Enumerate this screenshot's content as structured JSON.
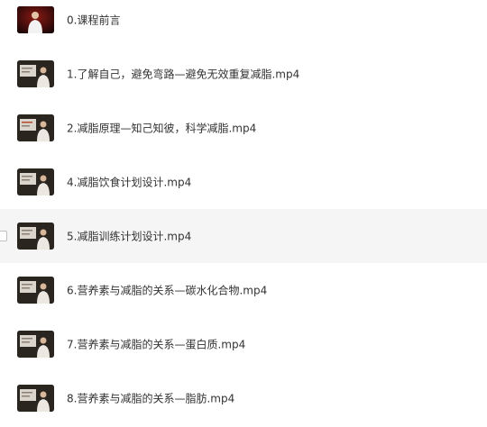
{
  "files": [
    {
      "name": "0.课程前言",
      "thumb": "intro"
    },
    {
      "name": "1.了解自己，避免弯路—避免无效重复减脂.mp4",
      "thumb": "lecture"
    },
    {
      "name": "2.减脂原理—知己知彼，科学减脂.mp4",
      "thumb": "lecture"
    },
    {
      "name": "4.减脂饮食计划设计.mp4",
      "thumb": "lecture"
    },
    {
      "name": "5.减脂训练计划设计.mp4",
      "thumb": "lecture"
    },
    {
      "name": "6.营养素与减脂的关系—碳水化合物.mp4",
      "thumb": "lecture"
    },
    {
      "name": "7.营养素与减脂的关系—蛋白质.mp4",
      "thumb": "lecture"
    },
    {
      "name": "8.营养素与减脂的关系—脂肪.mp4",
      "thumb": "lecture"
    }
  ],
  "hovered_index": 4,
  "colors": {
    "row_hover": "#f5f5f5",
    "text": "#333333"
  }
}
